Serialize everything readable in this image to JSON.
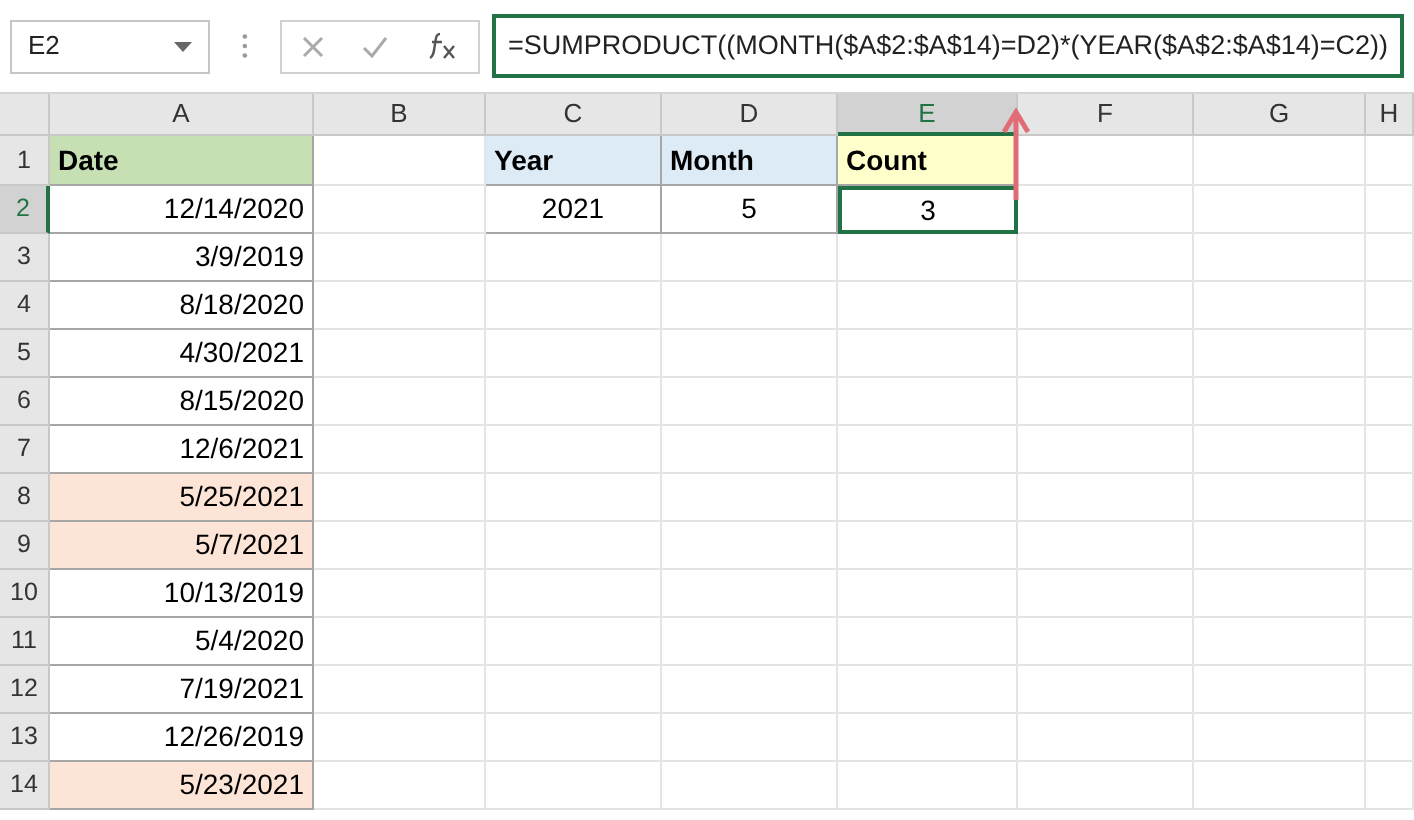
{
  "name_box": "E2",
  "formula": "=SUMPRODUCT((MONTH($A$2:$A$14)=D2)*(YEAR($A$2:$A$14)=C2))",
  "columns": [
    {
      "label": "A",
      "selected": false
    },
    {
      "label": "B",
      "selected": false
    },
    {
      "label": "C",
      "selected": false
    },
    {
      "label": "D",
      "selected": false
    },
    {
      "label": "E",
      "selected": true
    },
    {
      "label": "F",
      "selected": false
    },
    {
      "label": "G",
      "selected": false
    },
    {
      "label": "H",
      "selected": false
    }
  ],
  "rows": [
    {
      "number": "1",
      "selected": false,
      "cells": [
        {
          "kind": "header",
          "text": "Date",
          "color": "#c6e0b4"
        },
        null,
        {
          "kind": "header",
          "text": "Year",
          "color": "#ddebf7"
        },
        {
          "kind": "header",
          "text": "Month",
          "color": "#ddebf7"
        },
        {
          "kind": "header",
          "text": "Count",
          "color": "#ffffcc"
        },
        null,
        null,
        null
      ]
    },
    {
      "number": "2",
      "selected": true,
      "cells": [
        {
          "kind": "date",
          "text": "12/14/2020"
        },
        null,
        {
          "kind": "value",
          "text": "2021"
        },
        {
          "kind": "value",
          "text": "5"
        },
        {
          "kind": "value",
          "text": "3",
          "active": true
        },
        null,
        null,
        null
      ]
    },
    {
      "number": "3",
      "selected": false,
      "cells": [
        {
          "kind": "date",
          "text": "3/9/2019"
        },
        null,
        null,
        null,
        null,
        null,
        null,
        null
      ]
    },
    {
      "number": "4",
      "selected": false,
      "cells": [
        {
          "kind": "date",
          "text": "8/18/2020"
        },
        null,
        null,
        null,
        null,
        null,
        null,
        null
      ]
    },
    {
      "number": "5",
      "selected": false,
      "cells": [
        {
          "kind": "date",
          "text": "4/30/2021"
        },
        null,
        null,
        null,
        null,
        null,
        null,
        null
      ]
    },
    {
      "number": "6",
      "selected": false,
      "cells": [
        {
          "kind": "date",
          "text": "8/15/2020"
        },
        null,
        null,
        null,
        null,
        null,
        null,
        null
      ]
    },
    {
      "number": "7",
      "selected": false,
      "cells": [
        {
          "kind": "date",
          "text": "12/6/2021"
        },
        null,
        null,
        null,
        null,
        null,
        null,
        null
      ]
    },
    {
      "number": "8",
      "selected": false,
      "cells": [
        {
          "kind": "date",
          "text": "5/25/2021",
          "color": "#fce4d6"
        },
        null,
        null,
        null,
        null,
        null,
        null,
        null
      ]
    },
    {
      "number": "9",
      "selected": false,
      "cells": [
        {
          "kind": "date",
          "text": "5/7/2021",
          "color": "#fce4d6"
        },
        null,
        null,
        null,
        null,
        null,
        null,
        null
      ]
    },
    {
      "number": "10",
      "selected": false,
      "cells": [
        {
          "kind": "date",
          "text": "10/13/2019"
        },
        null,
        null,
        null,
        null,
        null,
        null,
        null
      ]
    },
    {
      "number": "11",
      "selected": false,
      "cells": [
        {
          "kind": "date",
          "text": "5/4/2020"
        },
        null,
        null,
        null,
        null,
        null,
        null,
        null
      ]
    },
    {
      "number": "12",
      "selected": false,
      "cells": [
        {
          "kind": "date",
          "text": "7/19/2021"
        },
        null,
        null,
        null,
        null,
        null,
        null,
        null
      ]
    },
    {
      "number": "13",
      "selected": false,
      "cells": [
        {
          "kind": "date",
          "text": "12/26/2019"
        },
        null,
        null,
        null,
        null,
        null,
        null,
        null
      ]
    },
    {
      "number": "14",
      "selected": false,
      "cells": [
        {
          "kind": "date",
          "text": "5/23/2021",
          "color": "#fce4d6"
        },
        null,
        null,
        null,
        null,
        null,
        null,
        null
      ]
    }
  ]
}
